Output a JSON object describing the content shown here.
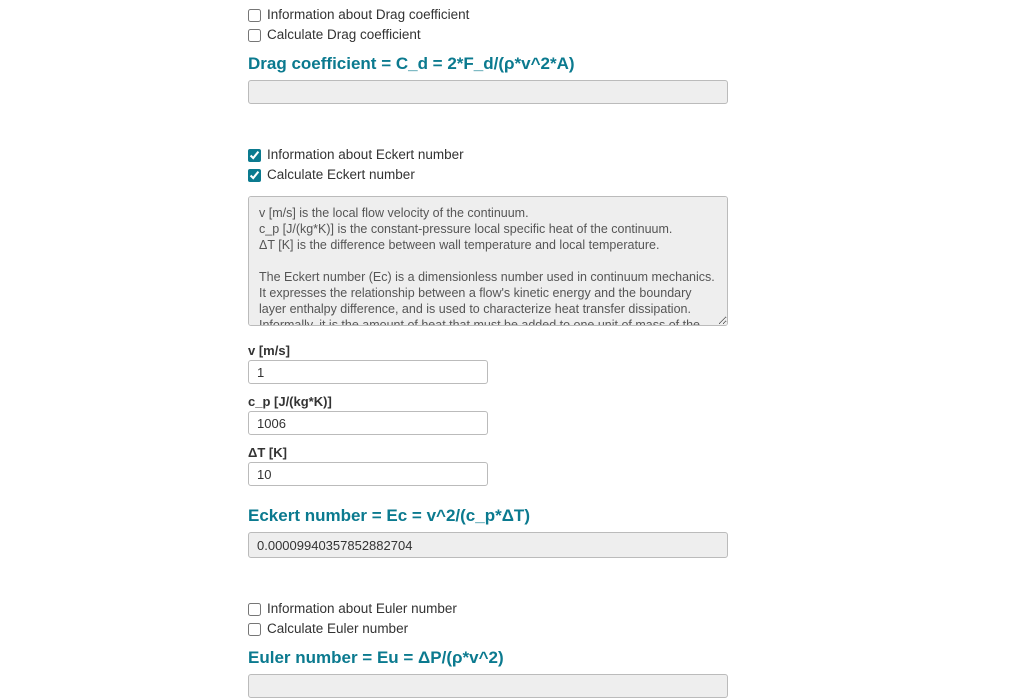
{
  "drag": {
    "infoCheckboxLabel": "Information about Drag coefficient",
    "calcCheckboxLabel": "Calculate Drag coefficient",
    "infoChecked": false,
    "calcChecked": false,
    "formulaHeader": "Drag coefficient = C_d = 2*F_d/(ρ*v^2*A)",
    "resultValue": ""
  },
  "eckert": {
    "infoCheckboxLabel": "Information about Eckert number",
    "calcCheckboxLabel": "Calculate Eckert number",
    "infoChecked": true,
    "calcChecked": true,
    "infoText": "v [m/s] is the local flow velocity of the continuum.\nc_p [J/(kg*K)] is the constant-pressure local specific heat of the continuum.\nΔT [K] is the difference between wall temperature and local temperature.\n\nThe Eckert number (Ec) is a dimensionless number used in continuum mechanics. It expresses the relationship between a flow's kinetic energy and the boundary layer enthalpy difference, and is used to characterize heat transfer dissipation. Informally, it is the amount of heat that must be added to one unit of mass of the substance in order to cause an increase of one unit in temperature.",
    "inputs": {
      "v": {
        "label": "v [m/s]",
        "value": "1"
      },
      "cp": {
        "label": "c_p [J/(kg*K)]",
        "value": "1006"
      },
      "dT": {
        "label": "ΔT [K]",
        "value": "10"
      }
    },
    "formulaHeader": "Eckert number = Ec = v^2/(c_p*ΔT)",
    "resultValue": "0.00009940357852882704"
  },
  "euler": {
    "infoCheckboxLabel": "Information about Euler number",
    "calcCheckboxLabel": "Calculate Euler number",
    "infoChecked": false,
    "calcChecked": false,
    "formulaHeader": "Euler number = Eu = ΔP/(ρ*v^2)",
    "resultValue": ""
  }
}
